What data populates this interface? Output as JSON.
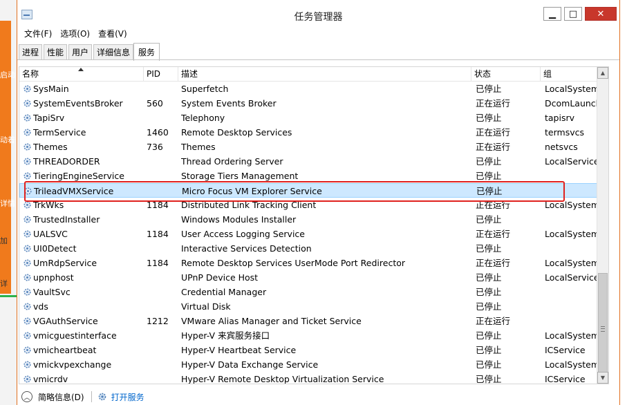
{
  "background": {
    "fragments": [
      "启动",
      "动着",
      "详情",
      "加",
      "详"
    ]
  },
  "window": {
    "title": "任务管理器",
    "buttons": {
      "minimize": "▁",
      "maximize": "□",
      "close": "✕"
    }
  },
  "menu": [
    "文件(F)",
    "选项(O)",
    "查看(V)"
  ],
  "tabs": [
    {
      "label": "进程",
      "active": false
    },
    {
      "label": "性能",
      "active": false
    },
    {
      "label": "用户",
      "active": false
    },
    {
      "label": "详细信息",
      "active": false
    },
    {
      "label": "服务",
      "active": true
    }
  ],
  "columns": {
    "name": "名称",
    "pid": "PID",
    "desc": "描述",
    "status": "状态",
    "group": "组"
  },
  "rows": [
    {
      "name": "SysMain",
      "pid": "",
      "desc": "Superfetch",
      "status": "已停止",
      "group": "LocalSystem..."
    },
    {
      "name": "SystemEventsBroker",
      "pid": "560",
      "desc": "System Events Broker",
      "status": "正在运行",
      "group": "DcomLaunch"
    },
    {
      "name": "TapiSrv",
      "pid": "",
      "desc": "Telephony",
      "status": "已停止",
      "group": "tapisrv"
    },
    {
      "name": "TermService",
      "pid": "1460",
      "desc": "Remote Desktop Services",
      "status": "正在运行",
      "group": "termsvcs"
    },
    {
      "name": "Themes",
      "pid": "736",
      "desc": "Themes",
      "status": "正在运行",
      "group": "netsvcs"
    },
    {
      "name": "THREADORDER",
      "pid": "",
      "desc": "Thread Ordering Server",
      "status": "已停止",
      "group": "LocalService"
    },
    {
      "name": "TieringEngineService",
      "pid": "",
      "desc": "Storage Tiers Management",
      "status": "已停止",
      "group": ""
    },
    {
      "name": "TrileadVMXService",
      "pid": "",
      "desc": "Micro Focus VM Explorer Service",
      "status": "已停止",
      "group": "",
      "selected": true
    },
    {
      "name": "TrkWks",
      "pid": "1184",
      "desc": "Distributed Link Tracking Client",
      "status": "正在运行",
      "group": "LocalSystem..."
    },
    {
      "name": "TrustedInstaller",
      "pid": "",
      "desc": "Windows Modules Installer",
      "status": "已停止",
      "group": ""
    },
    {
      "name": "UALSVC",
      "pid": "1184",
      "desc": "User Access Logging Service",
      "status": "正在运行",
      "group": "LocalSystem..."
    },
    {
      "name": "UI0Detect",
      "pid": "",
      "desc": "Interactive Services Detection",
      "status": "已停止",
      "group": ""
    },
    {
      "name": "UmRdpService",
      "pid": "1184",
      "desc": "Remote Desktop Services UserMode Port Redirector",
      "status": "正在运行",
      "group": "LocalSystem..."
    },
    {
      "name": "upnphost",
      "pid": "",
      "desc": "UPnP Device Host",
      "status": "已停止",
      "group": "LocalService..."
    },
    {
      "name": "VaultSvc",
      "pid": "",
      "desc": "Credential Manager",
      "status": "已停止",
      "group": ""
    },
    {
      "name": "vds",
      "pid": "",
      "desc": "Virtual Disk",
      "status": "已停止",
      "group": ""
    },
    {
      "name": "VGAuthService",
      "pid": "1212",
      "desc": "VMware Alias Manager and Ticket Service",
      "status": "正在运行",
      "group": ""
    },
    {
      "name": "vmicguestinterface",
      "pid": "",
      "desc": "Hyper-V 来宾服务接口",
      "status": "已停止",
      "group": "LocalSystem..."
    },
    {
      "name": "vmicheartbeat",
      "pid": "",
      "desc": "Hyper-V Heartbeat Service",
      "status": "已停止",
      "group": "ICService"
    },
    {
      "name": "vmickvpexchange",
      "pid": "",
      "desc": "Hyper-V Data Exchange Service",
      "status": "已停止",
      "group": "LocalSystem..."
    },
    {
      "name": "vmicrdv",
      "pid": "",
      "desc": "Hyper-V Remote Desktop Virtualization Service",
      "status": "已停止",
      "group": "ICService"
    }
  ],
  "footer": {
    "fewer_details": "简略信息(D)",
    "open_services": "打开服务"
  },
  "colors": {
    "selection": "#cde8ff",
    "highlight_box": "#e0201d",
    "close_button": "#c8372b",
    "link": "#0066cc"
  }
}
